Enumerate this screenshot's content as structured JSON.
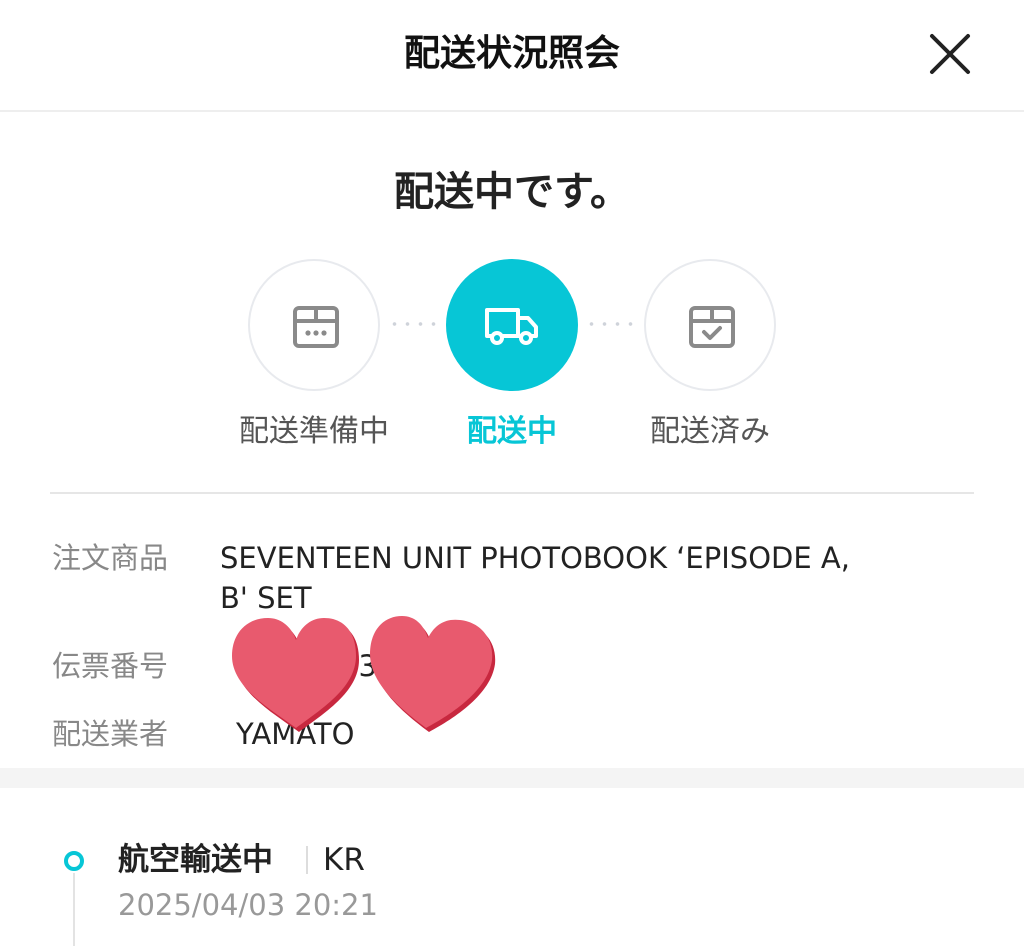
{
  "header": {
    "title": "配送状況照会"
  },
  "status": {
    "title": "配送中です。"
  },
  "steps": [
    {
      "label": "配送準備中",
      "icon": "box-pending-icon",
      "active": false
    },
    {
      "label": "配送中",
      "icon": "truck-icon",
      "active": true
    },
    {
      "label": "配送済み",
      "icon": "box-check-icon",
      "active": false
    }
  ],
  "details": {
    "product_label": "注文商品",
    "product_value_line1": "SEVENTEEN UNIT PHOTOBOOK ‘EPISODE A,",
    "product_value_line2": "B' SET",
    "tracking_label": "伝票番号",
    "tracking_value_visible": "23",
    "carrier_label": "配送業者",
    "carrier_value": "YAMATO"
  },
  "timeline": [
    {
      "status": "航空輸送中",
      "location": "KR",
      "time": "2025/04/03 20:21"
    }
  ],
  "colors": {
    "accent": "#07c6d6",
    "heart_fill": "#e85a6e",
    "heart_edge": "#c8283f"
  }
}
